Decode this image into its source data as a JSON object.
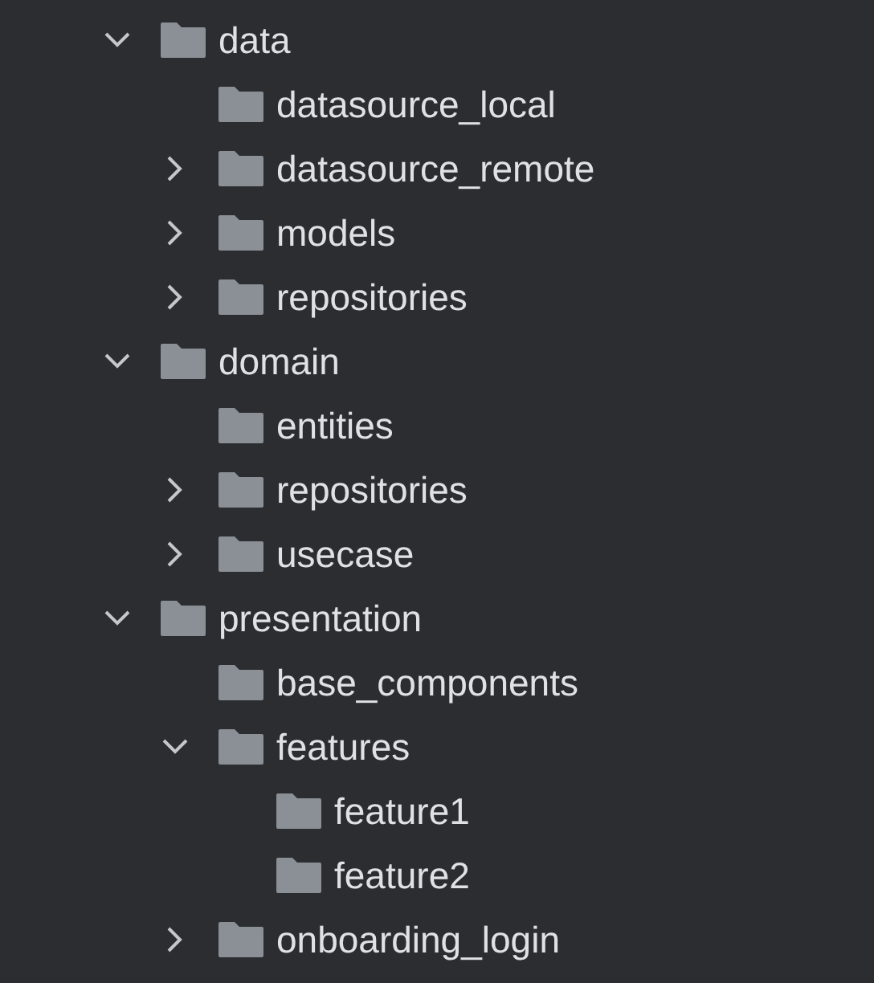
{
  "tree": [
    {
      "label": "data",
      "expanded": true,
      "children": [
        {
          "label": "datasource_local"
        },
        {
          "label": "datasource_remote",
          "expanded": false
        },
        {
          "label": "models",
          "expanded": false
        },
        {
          "label": "repositories",
          "expanded": false
        }
      ]
    },
    {
      "label": "domain",
      "expanded": true,
      "children": [
        {
          "label": "entities"
        },
        {
          "label": "repositories",
          "expanded": false
        },
        {
          "label": "usecase",
          "expanded": false
        }
      ]
    },
    {
      "label": "presentation",
      "expanded": true,
      "children": [
        {
          "label": "base_components"
        },
        {
          "label": "features",
          "expanded": true,
          "children": [
            {
              "label": "feature1"
            },
            {
              "label": "feature2"
            }
          ]
        },
        {
          "label": "onboarding_login",
          "expanded": false
        }
      ]
    }
  ]
}
